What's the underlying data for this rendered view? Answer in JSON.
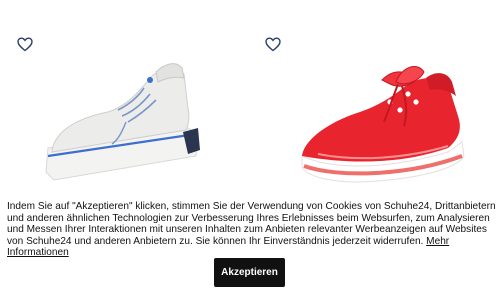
{
  "products": [
    {
      "favorite_icon": "heart-outline-icon",
      "image": "white-platform-sneaker-with-blue-stripe"
    },
    {
      "favorite_icon": "heart-outline-icon",
      "image": "red-suede-sneaker-with-satin-laces"
    }
  ],
  "cookie_banner": {
    "text": "Indem Sie auf \"Akzeptieren\" klicken, stimmen Sie der Verwendung von Cookies von Schuhe24, Drittanbietern und anderen ähnlichen Technologien zur Verbesserung Ihres Erlebnisses beim Websurfen, zum Analysieren und Messen Ihrer Interaktionen mit unseren Inhalten zum Anbieten relevanter Werbeanzeigen auf Websites von Schuhe24 und anderen Anbietern zu. Sie können Ihr Einverständnis jederzeit widerrufen.",
    "link_label": "Mehr Informationen",
    "accept_label": "Akzeptieren"
  },
  "colors": {
    "accent_dark": "#111111",
    "heart_outline": "#2b3f6b",
    "shoe_red": "#e8242f",
    "shoe_stripe_blue": "#3b6fd0"
  }
}
